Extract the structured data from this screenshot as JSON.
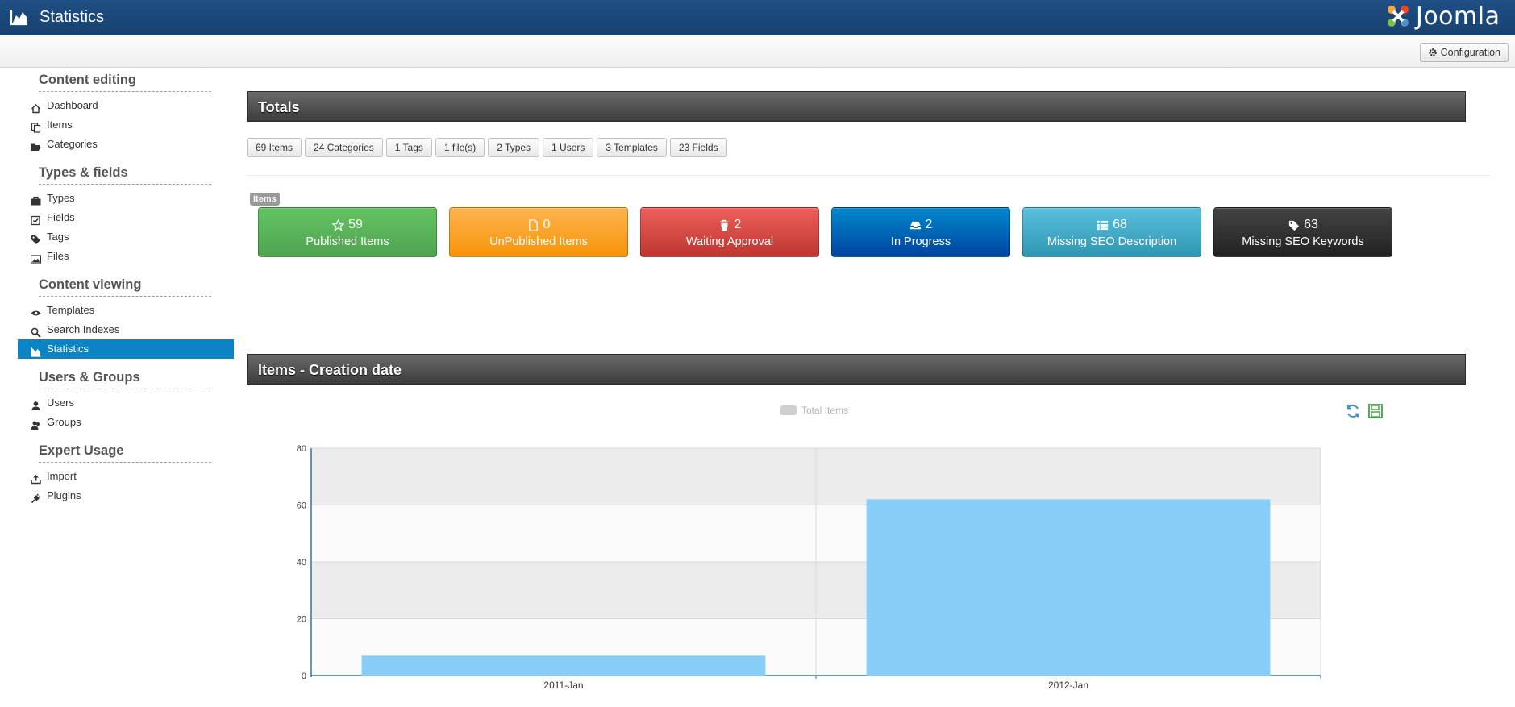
{
  "header": {
    "title": "Statistics",
    "brand": "Joomla!"
  },
  "toolbar": {
    "configuration_label": "Configuration"
  },
  "sidebar": {
    "sections": [
      {
        "title": "Content editing",
        "items": [
          "Dashboard",
          "Items",
          "Categories"
        ]
      },
      {
        "title": "Types & fields",
        "items": [
          "Types",
          "Fields",
          "Tags",
          "Files"
        ]
      },
      {
        "title": "Content viewing",
        "items": [
          "Templates",
          "Search Indexes",
          "Statistics"
        ]
      },
      {
        "title": "Users & Groups",
        "items": [
          "Users",
          "Groups"
        ]
      },
      {
        "title": "Expert Usage",
        "items": [
          "Import",
          "Plugins"
        ]
      }
    ],
    "active_item": "Statistics"
  },
  "totals": {
    "title": "Totals",
    "counts": [
      "69 Items",
      "24 Categories",
      "1 Tags",
      "1 file(s)",
      "2 Types",
      "1 Users",
      "3 Templates",
      "23 Fields"
    ],
    "items_label": "Items",
    "tiles": [
      {
        "value": "59",
        "label": "Published Items",
        "icon": "star-icon",
        "color": "#5bb75b"
      },
      {
        "value": "0",
        "label": "UnPublished Items",
        "icon": "file-icon",
        "color": "#faa732"
      },
      {
        "value": "2",
        "label": "Waiting Approval",
        "icon": "trash-icon",
        "color": "#da4f49"
      },
      {
        "value": "2",
        "label": "In Progress",
        "icon": "inbox-icon",
        "color": "#006dcc"
      },
      {
        "value": "68",
        "label": "Missing SEO Description",
        "icon": "list-icon",
        "color": "#49afcd"
      },
      {
        "value": "63",
        "label": "Missing SEO Keywords",
        "icon": "tag-icon",
        "color": "#363636"
      }
    ]
  },
  "chart_panel": {
    "title": "Items - Creation date"
  },
  "chart_data": {
    "type": "bar",
    "categories": [
      "2011-Jan",
      "2012-Jan"
    ],
    "series": [
      {
        "name": "Total Items",
        "values": [
          7,
          62
        ],
        "color": "#87cdf8"
      }
    ],
    "ylim": [
      0,
      80
    ],
    "yticks": [
      0,
      20,
      40,
      60,
      80
    ],
    "grid": true,
    "legend": "top-center"
  }
}
